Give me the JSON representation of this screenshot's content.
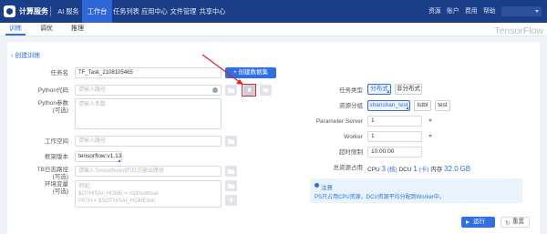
{
  "header": {
    "logo_text": "计算服务",
    "nav": [
      "AI 服务",
      "工作台",
      "任务列表",
      "应用中心",
      "文件管理",
      "共享中心"
    ],
    "nav_active": 1,
    "right_links": [
      "资源",
      "账户",
      "费用",
      "帮助"
    ],
    "brand_right": "TensorFlow"
  },
  "subtabs": [
    "训练",
    "调优",
    "推理"
  ],
  "subtab_active": 0,
  "page": {
    "back_label": "创建训练"
  },
  "form_left": {
    "task_name": {
      "label": "任务名",
      "value": "TF_Task_2108105465",
      "create_button": "创建数据集"
    },
    "python_code": {
      "label": "Python代码",
      "placeholder": "请输入路径"
    },
    "python_params": {
      "label": "Python参数",
      "label_note": "(可选)",
      "placeholder": "请输入参数"
    },
    "workspace": {
      "label": "工作空间",
      "placeholder": "请输入路径"
    },
    "framework_version": {
      "label": "框架版本",
      "value": "tensorflow:v1.13"
    },
    "tb_log_path": {
      "label": "TB日志路径",
      "label_note": "(可选)",
      "placeholder": "请输入TensorBoard的日志输出路径"
    },
    "env_vars": {
      "label": "环境变量",
      "label_note": "(可选)",
      "placeholder_lines": [
        "例如:",
        "$OTHISAI_HOME = /opt/sothisai",
        "PATH = $SOTHISAI_HOME/bin"
      ]
    }
  },
  "form_right": {
    "task_type": {
      "label": "任务类型",
      "options": [
        "分布式",
        "非分布式"
      ],
      "selected": 0
    },
    "resource_group": {
      "label": "资源分组",
      "options": [
        "shanshan_test",
        "lstbl",
        "test"
      ],
      "selected": 0
    },
    "parameter_server": {
      "label": "Parameter Server",
      "value": "1"
    },
    "worker": {
      "label": "Worker",
      "value": "1"
    },
    "timeout": {
      "label": "超时限制",
      "value": "10:00:00"
    },
    "usage": {
      "label": "总资源占用",
      "cpu_label": "CPU",
      "cpu_value": "3",
      "cpu_unit": "(核)",
      "dcu_label": "DCU",
      "dcu_value": "1",
      "dcu_unit": "(卡)",
      "mem_label": "内存",
      "mem_value": "32.0",
      "mem_unit": "GB"
    }
  },
  "note": {
    "title": "注意",
    "body": "PS只占用CPU资源，DCU资源平均分配到Worker中。"
  },
  "actions": {
    "run": "运行",
    "reset": "重置"
  },
  "colors": {
    "header": "#1a3f88",
    "accent": "#2f6fe0",
    "highlight": "#e0202a"
  }
}
